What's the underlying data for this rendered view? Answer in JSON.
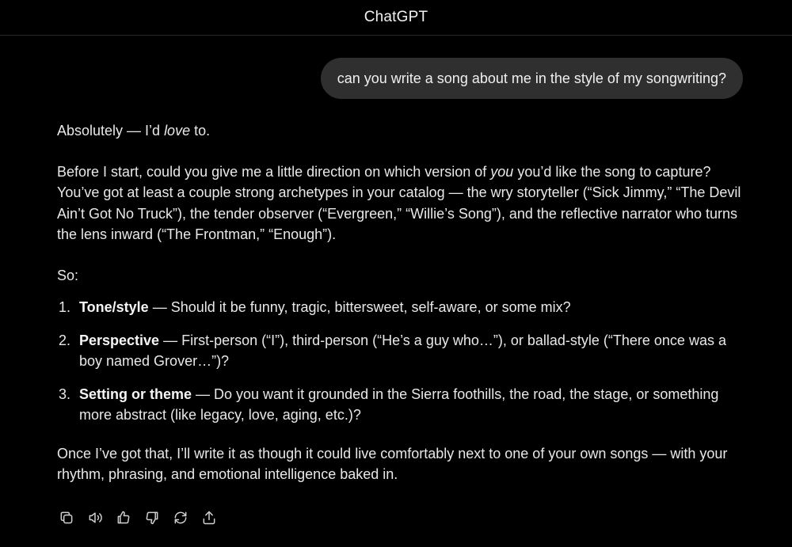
{
  "header": {
    "title": "ChatGPT"
  },
  "user_message": {
    "text": "can you write a song about me in the style of my songwriting?"
  },
  "assistant_message": {
    "greeting_prefix": "Absolutely — I’d ",
    "greeting_emphasis": "love",
    "greeting_suffix": " to.",
    "intro_part1": "Before I start, could you give me a little direction on which version of ",
    "intro_emphasis": "you",
    "intro_part2": " you’d like the song to capture? You’ve got at least a couple strong archetypes in your catalog — the wry storyteller (“Sick Jimmy,” “The Devil Ain’t Got No Truck”), the tender observer (“Evergreen,” “Willie’s Song”), and the reflective narrator who turns the lens inward (“The Frontman,” “Enough”).",
    "so": "So:",
    "list": [
      {
        "number": "1.",
        "heading": "Tone/style",
        "text": " — Should it be funny, tragic, bittersweet, self-aware, or some mix?"
      },
      {
        "number": "2.",
        "heading": "Perspective",
        "text": " — First-person (“I”), third-person (“He’s a guy who…”), or ballad-style (“There once was a boy named Grover…”)?"
      },
      {
        "number": "3.",
        "heading": "Setting or theme",
        "text": " — Do you want it grounded in the Sierra foothills, the road, the stage, or something more abstract (like legacy, love, aging, etc.)?"
      }
    ],
    "closing": "Once I’ve got that, I’ll write it as though it could live comfortably next to one of your own songs — with your rhythm, phrasing, and emotional intelligence baked in."
  },
  "action_bar": {
    "icons": [
      "copy-icon",
      "read-aloud-icon",
      "thumbs-up-icon",
      "thumbs-down-icon",
      "regenerate-icon",
      "share-icon"
    ]
  },
  "colors": {
    "background": "#000000",
    "bubble": "#2f2f2f",
    "text": "#e8e8e8"
  }
}
